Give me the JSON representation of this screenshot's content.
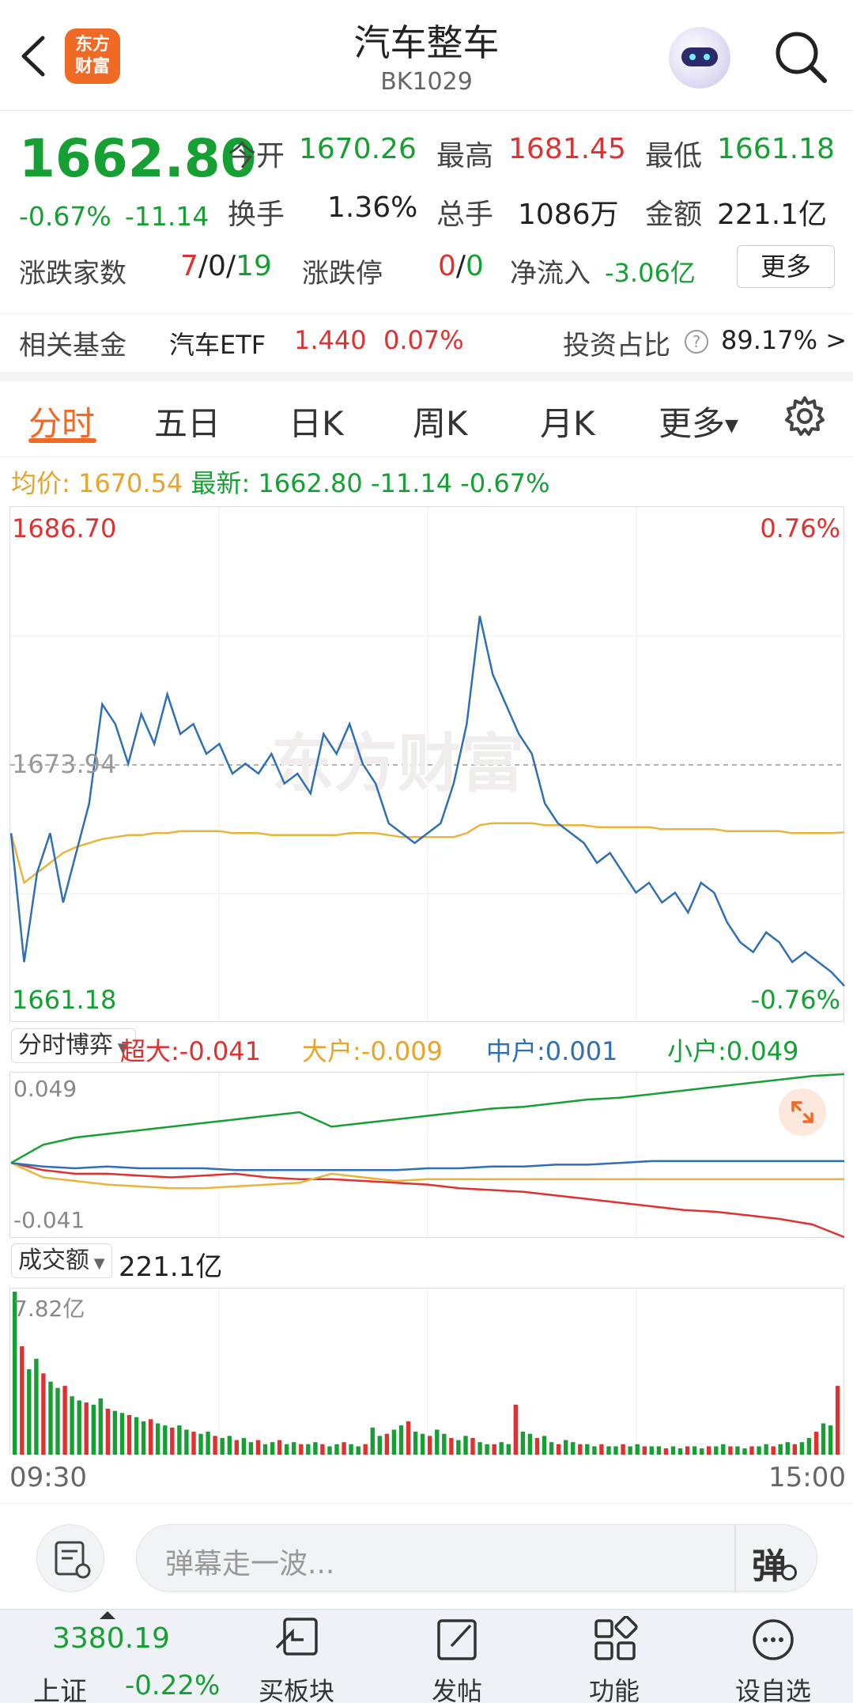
{
  "header": {
    "title": "汽车整车",
    "code": "BK1029",
    "logo_text_1": "东方",
    "logo_text_2": "财富"
  },
  "quote": {
    "price": "1662.80",
    "change_pct": "-0.67%",
    "change_abs": "-11.14",
    "open_label": "今开",
    "open": "1670.26",
    "high_label": "最高",
    "high": "1681.45",
    "low_label": "最低",
    "low": "1661.18",
    "turnover_label": "换手",
    "turnover": "1.36%",
    "volume_label": "总手",
    "volume": "1086万",
    "amount_label": "金额",
    "amount": "221.1亿",
    "breadth_label": "涨跌家数",
    "breadth_up": "7",
    "breadth_flat": "0",
    "breadth_down": "19",
    "breadth_sep": "/",
    "limit_label": "涨跌停",
    "limit_up": "0",
    "limit_down": "0",
    "netflow_label": "净流入",
    "netflow": "-3.06亿",
    "more_button": "更多"
  },
  "fund": {
    "label": "相关基金",
    "name": "汽车ETF",
    "price": "1.440",
    "change": "0.07%",
    "ratio_label": "投资占比",
    "ratio": "89.17% >",
    "help_icon": "?"
  },
  "tabs": [
    "分时",
    "五日",
    "日K",
    "周K",
    "月K",
    "更多"
  ],
  "avg_line": {
    "avg_label": "均价:",
    "avg_value": "1670.54",
    "latest_label": "最新:",
    "latest_value": "1662.80",
    "latest_chg": "-11.14",
    "latest_pct": "-0.67%"
  },
  "price_chart": {
    "y_top": "1686.70",
    "y_top_pct": "0.76%",
    "y_mid": "1673.94",
    "y_bottom": "1661.18",
    "y_bottom_pct": "-0.76%",
    "watermark": "东方财富"
  },
  "flow_chart": {
    "selector": "分时博弈",
    "super_label": "超大:",
    "super_value": "-0.041",
    "big_label": "大户:",
    "big_value": "-0.009",
    "mid_label": "中户:",
    "mid_value": "0.001",
    "small_label": "小户:",
    "small_value": "0.049",
    "y_top": "0.049",
    "y_bottom": "-0.041"
  },
  "volume_chart": {
    "selector": "成交额",
    "total": "221.1亿",
    "y_top": "7.82亿",
    "time_start": "09:30",
    "time_end": "15:00"
  },
  "barrage": {
    "placeholder": "弹幕走一波...",
    "toggle_label": "弹"
  },
  "bottom_nav": {
    "index_value": "3380.19",
    "index_name": "上证",
    "index_change": "-0.22%",
    "items": [
      "买板块",
      "发帖",
      "功能",
      "设自选"
    ]
  },
  "colors": {
    "up": "#e03131",
    "down": "#16a034",
    "accent": "#f06a26",
    "price_line": "#2f6fb6",
    "avg_line": "#e8b43a"
  },
  "chart_data": [
    {
      "type": "line",
      "title": "",
      "xlabel": "",
      "ylabel": "",
      "x_range": [
        "09:30",
        "15:00"
      ],
      "ylim": [
        1661.18,
        1686.7
      ],
      "series": [
        {
          "values": [
            1670.5,
            1664.0,
            1668.5,
            1670.5,
            1667.0,
            1669.5,
            1672.0,
            1677.0,
            1676.0,
            1674.0,
            1676.5,
            1675.0,
            1677.5,
            1675.5,
            1676.0,
            1674.5,
            1675.0,
            1673.5,
            1674.0,
            1673.5,
            1674.5,
            1673.0,
            1673.5,
            1672.5,
            1675.5,
            1674.5,
            1676.0,
            1674.0,
            1673.0,
            1671.0,
            1670.5,
            1670.0,
            1670.5,
            1671.0,
            1673.0,
            1676.0,
            1681.45,
            1678.5,
            1677.0,
            1675.5,
            1674.5,
            1672.0,
            1671.0,
            1670.5,
            1670.0,
            1669.0,
            1669.5,
            1668.5,
            1667.5,
            1668.0,
            1667.0,
            1667.5,
            1666.5,
            1668.0,
            1667.5,
            1666.0,
            1665.0,
            1664.5,
            1665.5,
            1665.0,
            1664.0,
            1664.5,
            1664.0,
            1663.5,
            1662.8
          ]
        },
        {
          "values": [
            1670.5,
            1668.0,
            1668.5,
            1669.0,
            1669.5,
            1669.8,
            1670.0,
            1670.2,
            1670.3,
            1670.4,
            1670.4,
            1670.5,
            1670.5,
            1670.6,
            1670.6,
            1670.6,
            1670.6,
            1670.5,
            1670.5,
            1670.5,
            1670.4,
            1670.4,
            1670.4,
            1670.4,
            1670.4,
            1670.4,
            1670.5,
            1670.5,
            1670.5,
            1670.4,
            1670.3,
            1670.3,
            1670.3,
            1670.3,
            1670.3,
            1670.5,
            1670.9,
            1671.0,
            1671.0,
            1671.0,
            1671.0,
            1670.9,
            1670.9,
            1670.9,
            1670.9,
            1670.8,
            1670.8,
            1670.8,
            1670.8,
            1670.8,
            1670.7,
            1670.7,
            1670.7,
            1670.7,
            1670.7,
            1670.6,
            1670.6,
            1670.6,
            1670.6,
            1670.6,
            1670.5,
            1670.5,
            1670.5,
            1670.5,
            1670.54
          ]
        }
      ]
    },
    {
      "type": "line",
      "title": "",
      "ylim": [
        -0.041,
        0.049
      ],
      "series": [
        {
          "name": "超大",
          "values": [
            0,
            -0.004,
            -0.006,
            -0.006,
            -0.007,
            -0.008,
            -0.007,
            -0.006,
            -0.008,
            -0.009,
            -0.009,
            -0.01,
            -0.011,
            -0.012,
            -0.014,
            -0.015,
            -0.016,
            -0.018,
            -0.02,
            -0.022,
            -0.024,
            -0.026,
            -0.027,
            -0.029,
            -0.031,
            -0.034,
            -0.041
          ]
        },
        {
          "name": "大户",
          "values": [
            0,
            -0.008,
            -0.01,
            -0.012,
            -0.013,
            -0.014,
            -0.014,
            -0.013,
            -0.012,
            -0.011,
            -0.006,
            -0.008,
            -0.01,
            -0.009,
            -0.009,
            -0.009,
            -0.009,
            -0.009,
            -0.009,
            -0.009,
            -0.009,
            -0.009,
            -0.009,
            -0.009,
            -0.009,
            -0.009,
            -0.009
          ]
        },
        {
          "name": "中户",
          "values": [
            0,
            -0.002,
            -0.003,
            -0.002,
            -0.003,
            -0.003,
            -0.003,
            -0.004,
            -0.004,
            -0.004,
            -0.004,
            -0.004,
            -0.004,
            -0.003,
            -0.003,
            -0.002,
            -0.002,
            -0.001,
            -0.001,
            0.0,
            0.001,
            0.001,
            0.001,
            0.001,
            0.001,
            0.001,
            0.001
          ]
        },
        {
          "name": "小户",
          "values": [
            0,
            0.01,
            0.014,
            0.016,
            0.018,
            0.02,
            0.022,
            0.024,
            0.026,
            0.028,
            0.02,
            0.022,
            0.024,
            0.026,
            0.028,
            0.03,
            0.031,
            0.033,
            0.035,
            0.036,
            0.038,
            0.04,
            0.042,
            0.044,
            0.046,
            0.048,
            0.049
          ]
        }
      ]
    },
    {
      "type": "bar",
      "title": "",
      "ylim": [
        0,
        7.82
      ],
      "values": [
        7.82,
        5.2,
        4.1,
        4.6,
        3.9,
        3.5,
        3.2,
        3.3,
        2.8,
        2.6,
        2.5,
        2.4,
        2.7,
        2.2,
        2.1,
        2.0,
        1.9,
        1.8,
        1.6,
        1.7,
        1.5,
        1.4,
        1.3,
        1.4,
        1.2,
        1.1,
        1.0,
        1.1,
        0.9,
        0.8,
        0.9,
        0.7,
        0.8,
        0.6,
        0.7,
        0.5,
        0.6,
        0.7,
        0.5,
        0.6,
        0.5,
        0.5,
        0.6,
        0.5,
        0.4,
        0.5,
        0.6,
        0.5,
        0.4,
        0.5,
        1.3,
        0.9,
        1.0,
        1.2,
        1.4,
        1.6,
        1.1,
        1.0,
        0.9,
        1.2,
        1.0,
        0.8,
        0.7,
        0.9,
        0.8,
        0.6,
        0.5,
        0.5,
        0.6,
        0.5,
        2.4,
        1.1,
        1.0,
        0.8,
        0.9,
        0.6,
        0.5,
        0.7,
        0.6,
        0.5,
        0.5,
        0.4,
        0.5,
        0.4,
        0.4,
        0.5,
        0.4,
        0.5,
        0.4,
        0.4,
        0.4,
        0.3,
        0.4,
        0.3,
        0.4,
        0.4,
        0.3,
        0.4,
        0.4,
        0.5,
        0.4,
        0.4,
        0.3,
        0.4,
        0.4,
        0.5,
        0.4,
        0.5,
        0.6,
        0.5,
        0.6,
        0.8,
        1.1,
        1.5,
        1.4,
        3.3
      ]
    }
  ]
}
